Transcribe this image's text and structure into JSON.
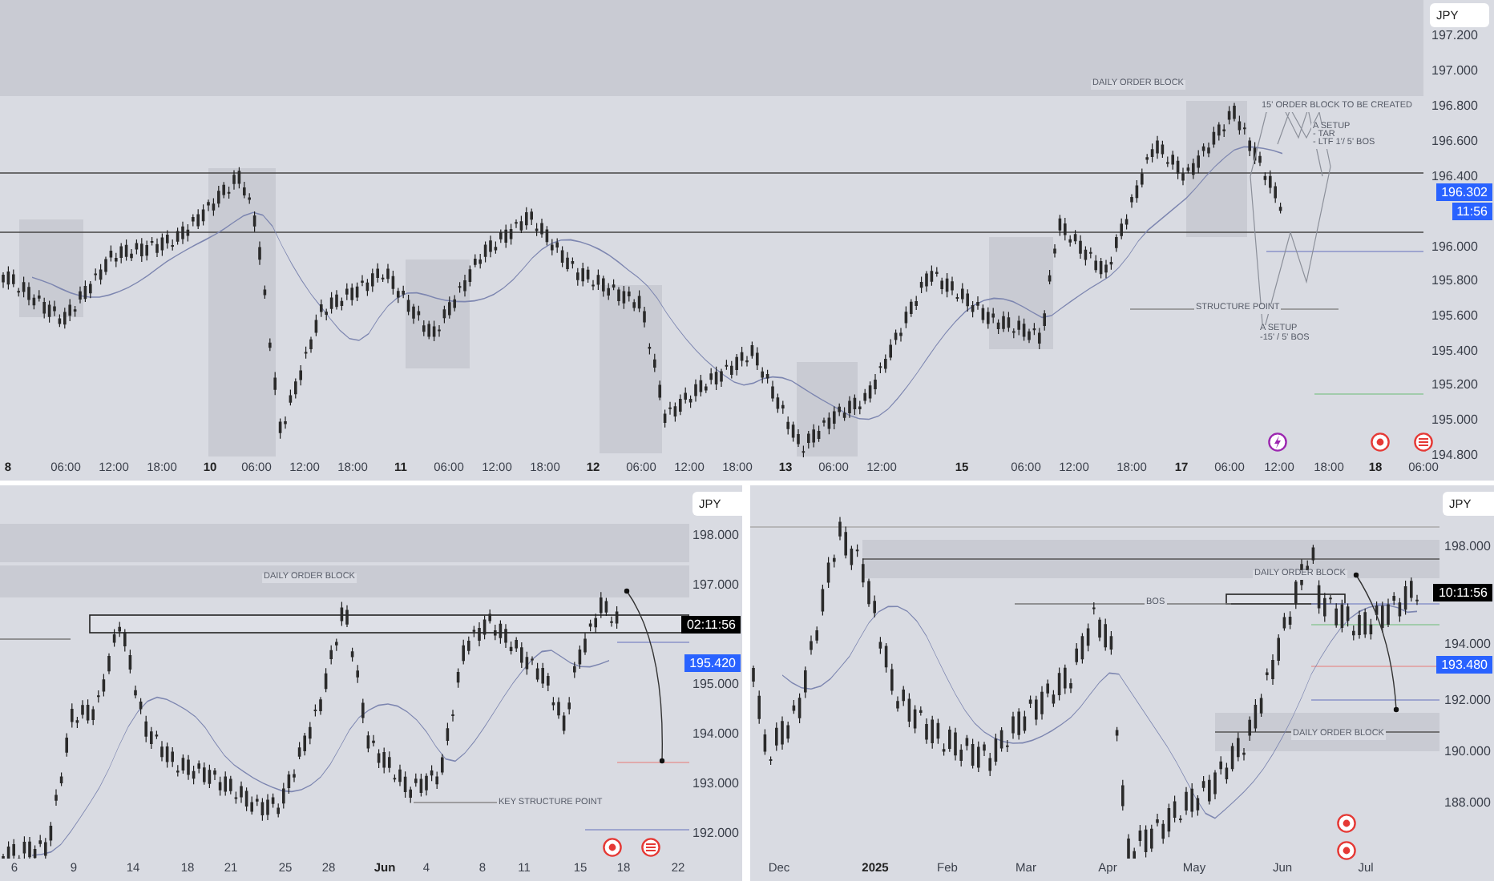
{
  "panels": [
    {
      "kind": "intraday",
      "currency": "JPY",
      "price_ticks": [
        "197.200",
        "197.000",
        "196.800",
        "196.600",
        "196.400",
        "196.000",
        "195.800",
        "195.600",
        "195.400",
        "195.200",
        "195.000",
        "194.800"
      ],
      "price_tags": [
        {
          "text": "196.302",
          "color": "#2962ff"
        },
        {
          "text": "11:56",
          "color": "#2962ff"
        }
      ],
      "time_ticks": [
        {
          "label": "8",
          "major": true
        },
        {
          "label": "06:00",
          "major": false
        },
        {
          "label": "12:00",
          "major": false
        },
        {
          "label": "18:00",
          "major": false
        },
        {
          "label": "10",
          "major": true
        },
        {
          "label": "06:00",
          "major": false
        },
        {
          "label": "12:00",
          "major": false
        },
        {
          "label": "18:00",
          "major": false
        },
        {
          "label": "11",
          "major": true
        },
        {
          "label": "06:00",
          "major": false
        },
        {
          "label": "12:00",
          "major": false
        },
        {
          "label": "18:00",
          "major": false
        },
        {
          "label": "12",
          "major": true
        },
        {
          "label": "06:00",
          "major": false
        },
        {
          "label": "12:00",
          "major": false
        },
        {
          "label": "18:00",
          "major": false
        },
        {
          "label": "13",
          "major": true
        },
        {
          "label": "06:00",
          "major": false
        },
        {
          "label": "12:00",
          "major": false
        },
        {
          "label": "15",
          "major": true
        },
        {
          "label": "06:00",
          "major": false
        },
        {
          "label": "12:00",
          "major": false
        },
        {
          "label": "18:00",
          "major": false
        },
        {
          "label": "17",
          "major": true
        },
        {
          "label": "06:00",
          "major": false
        },
        {
          "label": "12:00",
          "major": false
        },
        {
          "label": "18:00",
          "major": false
        },
        {
          "label": "18",
          "major": true
        },
        {
          "label": "06:00",
          "major": false
        }
      ],
      "annotations": [
        "DAILY ORDER BLOCK",
        "15' ORDER BLOCK TO BE CREATED",
        "A SETUP",
        "- TAR",
        "- LTF 1'/ 5' BOS",
        "STRUCTURE POINT",
        "A SETUP",
        "-15' / 5' BOS"
      ]
    },
    {
      "kind": "daily",
      "currency": "JPY",
      "price_ticks": [
        "198.000",
        "197.000",
        "195.000",
        "194.000",
        "193.000",
        "192.000"
      ],
      "price_tags": [
        {
          "text": "02:11:56",
          "color": "#000000"
        },
        {
          "text": "195.420",
          "color": "#2962ff"
        }
      ],
      "time_ticks": [
        {
          "label": "6",
          "major": false
        },
        {
          "label": "9",
          "major": false
        },
        {
          "label": "14",
          "major": false
        },
        {
          "label": "18",
          "major": false
        },
        {
          "label": "21",
          "major": false
        },
        {
          "label": "25",
          "major": false
        },
        {
          "label": "28",
          "major": false
        },
        {
          "label": "Jun",
          "major": true
        },
        {
          "label": "4",
          "major": false
        },
        {
          "label": "8",
          "major": false
        },
        {
          "label": "11",
          "major": false
        },
        {
          "label": "15",
          "major": false
        },
        {
          "label": "18",
          "major": false
        },
        {
          "label": "22",
          "major": false
        }
      ],
      "annotations": [
        "DAILY ORDER BLOCK",
        "KEY STRUCTURE POINT"
      ]
    },
    {
      "kind": "weekly",
      "currency": "JPY",
      "price_ticks": [
        "198.000",
        "194.000",
        "192.000",
        "190.000",
        "188.000"
      ],
      "price_tags": [
        {
          "text": "10:11:56",
          "color": "#000000"
        },
        {
          "text": "193.480",
          "color": "#2962ff"
        }
      ],
      "time_ticks": [
        {
          "label": "Dec",
          "major": false
        },
        {
          "label": "2025",
          "major": true
        },
        {
          "label": "Feb",
          "major": false
        },
        {
          "label": "Mar",
          "major": false
        },
        {
          "label": "Apr",
          "major": false
        },
        {
          "label": "May",
          "major": false
        },
        {
          "label": "Jun",
          "major": false
        },
        {
          "label": "Jul",
          "major": false
        }
      ],
      "annotations": [
        "DAILY ORDER BLOCK",
        "BOS",
        "DAILY ORDER BLOCK"
      ]
    }
  ]
}
